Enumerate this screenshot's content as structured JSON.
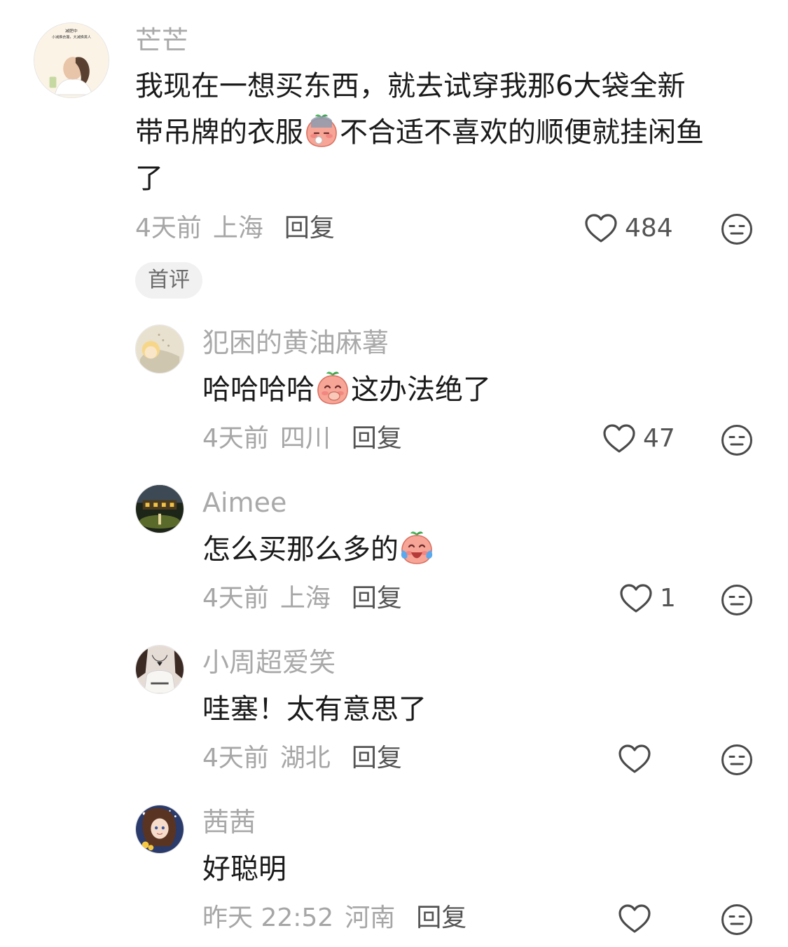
{
  "comments": [
    {
      "username": "芒芒",
      "avatar_text": [
        "减肥中",
        "小减换衣服，大减换男人"
      ],
      "content_lines": [
        "我现在一想买东西，就去试穿我那6大袋全新",
        "带吊牌的衣服",
        "不合适不喜欢的顺便就挂闲鱼",
        "了"
      ],
      "time": "4天前",
      "location": "上海",
      "reply_label": "回复",
      "likes": "484",
      "badge": "首评"
    },
    {
      "username": "犯困的黄油麻薯",
      "content": [
        "哈哈哈哈",
        "这办法绝了"
      ],
      "time": "4天前",
      "location": "四川",
      "reply_label": "回复",
      "likes": "47"
    },
    {
      "username": "Aimee",
      "content": [
        "怎么买那么多的"
      ],
      "time": "4天前",
      "location": "上海",
      "reply_label": "回复",
      "likes": "1"
    },
    {
      "username": "小周超爱笑",
      "content": [
        "哇塞！太有意思了"
      ],
      "time": "4天前",
      "location": "湖北",
      "reply_label": "回复",
      "likes": ""
    },
    {
      "username": "茜茜",
      "content": [
        "好聪明"
      ],
      "time": "昨天 22:52",
      "location": "河南",
      "reply_label": "回复",
      "likes": ""
    }
  ],
  "icons": {
    "like": "heart-outline-icon",
    "dislike": "neutral-face-icon",
    "emoji_1": "sweating-peach-emoji",
    "emoji_2": "laughing-peach-emoji",
    "emoji_3": "crying-laughing-peach-emoji"
  },
  "colors": {
    "username": "#a9a9a9",
    "meta": "#a6a6a6",
    "reply": "#555555",
    "badge_bg": "#f1f1f1"
  }
}
